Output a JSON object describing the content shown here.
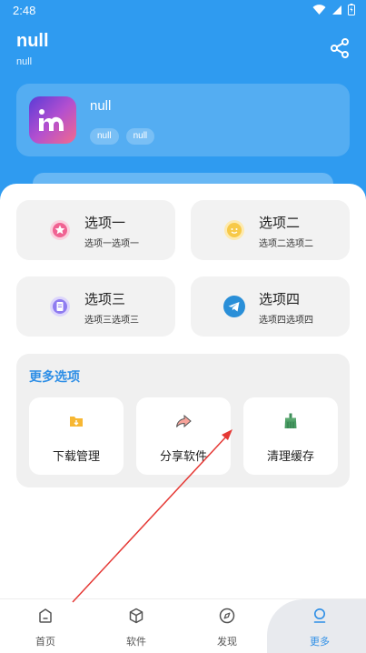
{
  "status_bar": {
    "time": "2:48"
  },
  "header": {
    "title": "null",
    "subtitle": "null",
    "share_icon": "share-icon"
  },
  "profile": {
    "name": "null",
    "tags": [
      "null",
      "null"
    ],
    "avatar_letter": "m"
  },
  "options": [
    {
      "title": "选项一",
      "subtitle": "选项一选项一",
      "icon": "star-badge-icon",
      "color": "#f06292"
    },
    {
      "title": "选项二",
      "subtitle": "选项二选项二",
      "icon": "smile-badge-icon",
      "color": "#f7c948"
    },
    {
      "title": "选项三",
      "subtitle": "选项三选项三",
      "icon": "document-badge-icon",
      "color": "#8f7cf0"
    },
    {
      "title": "选项四",
      "subtitle": "选项四选项四",
      "icon": "telegram-icon",
      "color": "#2a8fd8"
    }
  ],
  "more": {
    "title": "更多选项",
    "tools": [
      {
        "label": "下载管理",
        "icon": "download-folder-icon"
      },
      {
        "label": "分享软件",
        "icon": "share-arrow-icon"
      },
      {
        "label": "清理缓存",
        "icon": "broom-icon"
      }
    ]
  },
  "nav": [
    {
      "label": "首页",
      "icon": "home-icon"
    },
    {
      "label": "软件",
      "icon": "cube-icon"
    },
    {
      "label": "发现",
      "icon": "compass-icon"
    },
    {
      "label": "更多",
      "icon": "user-icon",
      "active": true
    }
  ],
  "colors": {
    "primary": "#2f9bf0",
    "accent": "#2f8fe6",
    "annotation": "#e53935"
  }
}
